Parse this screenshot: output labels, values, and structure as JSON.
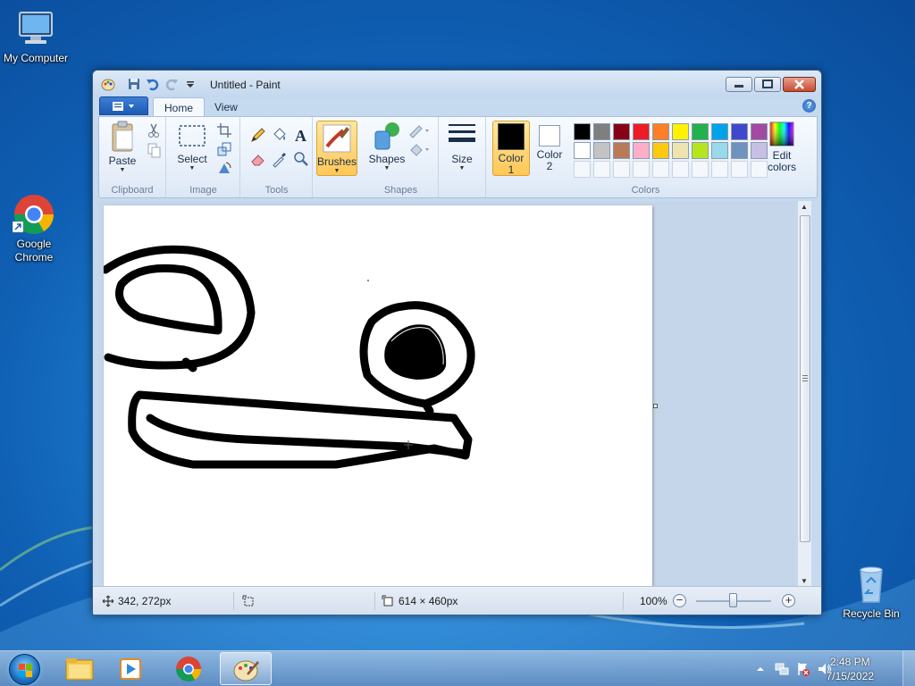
{
  "desktop": {
    "icons": [
      {
        "label": "My Computer"
      },
      {
        "label": "Google Chrome"
      },
      {
        "label": "Recycle Bin"
      }
    ]
  },
  "window": {
    "title": "Untitled - Paint",
    "tabs": [
      {
        "label": "Home"
      },
      {
        "label": "View"
      }
    ],
    "ribbon": {
      "clipboard": {
        "group_label": "Clipboard",
        "paste_label": "Paste"
      },
      "image": {
        "group_label": "Image",
        "select_label": "Select"
      },
      "tools": {
        "group_label": "Tools"
      },
      "brushes": {
        "label": "Brushes"
      },
      "shapes": {
        "group_label": "Shapes",
        "shapes_label": "Shapes"
      },
      "size": {
        "label": "Size"
      },
      "colors": {
        "group_label": "Colors",
        "color1_label": "Color\n1",
        "color1_line1": "Color",
        "color1_line2": "1",
        "color2_line1": "Color",
        "color2_line2": "2",
        "color1_value": "#000000",
        "color2_value": "#ffffff",
        "edit_line1": "Edit",
        "edit_line2": "colors",
        "palette_row1": [
          "#000000",
          "#7f7f7f",
          "#880015",
          "#ed1c24",
          "#ff7f27",
          "#fff200",
          "#22b14c",
          "#00a2e8",
          "#3f48cc",
          "#a349a4"
        ],
        "palette_row2": [
          "#ffffff",
          "#c3c3c3",
          "#b97a57",
          "#ffaec9",
          "#ffc90e",
          "#efe4b0",
          "#b5e61d",
          "#99d9ea",
          "#7092be",
          "#c8bfe7"
        ]
      }
    },
    "status": {
      "cursor_pos": "342, 272px",
      "image_size": "614 × 460px",
      "zoom": "100%"
    }
  },
  "taskbar": {
    "time": "2:48 PM",
    "date": "7/15/2022"
  }
}
